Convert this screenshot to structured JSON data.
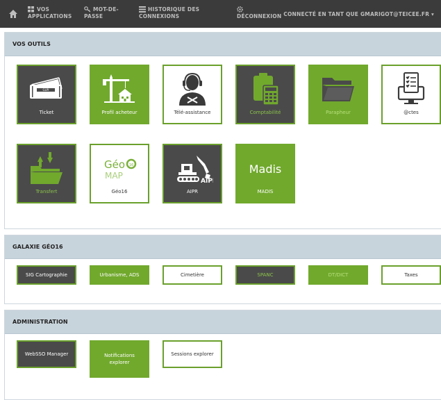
{
  "nav": {
    "apps": "VOS APPLICATIONS",
    "apps_line1": "VOS",
    "apps_line2": "APPLICATIONS",
    "pwd_line1": "MOT-DE-",
    "pwd_line2": "PASSE",
    "hist_line1": "HISTORIQUE DES",
    "hist_line2": "CONNEXIONS",
    "logout": "DÉCONNEXION",
    "user": "CONNECTÉ EN TANT QUE GMARIGOT@TEICEE.FR"
  },
  "tools": {
    "title": "VOS OUTILS",
    "tiles": [
      {
        "label": "Ticket",
        "icon": "ticket-icon"
      },
      {
        "label": "Profil acheteur",
        "icon": "crane-icon"
      },
      {
        "label": "Télé-assistance",
        "icon": "headset-icon"
      },
      {
        "label": "Comptabilité",
        "icon": "calculator-icon"
      },
      {
        "label": "Parapheur",
        "icon": "folder-icon"
      },
      {
        "label": "@ctes",
        "icon": "monitor-checklist-icon"
      },
      {
        "label": "Transfert",
        "icon": "folder-transfer-icon"
      },
      {
        "label": "Géo16",
        "icon": "geo16-logo",
        "logo_top": "GéoC",
        "logo_bottom": "MAP",
        "logo_badge": "16"
      },
      {
        "label": "AIPR",
        "icon": "excavator-icon",
        "logo_text": "AIPR"
      },
      {
        "label": "MADIS",
        "icon": "madis-logo",
        "logo_text": "Madis"
      }
    ]
  },
  "geo": {
    "title": "GALAXIE GÉO16",
    "buttons": [
      "SIG Cartographie",
      "Urbanisme, ADS",
      "Cimetière",
      "SPANC",
      "DT/DICT",
      "Taxes"
    ]
  },
  "admin": {
    "title": "ADMINISTRATION",
    "buttons": [
      "WebSSO Manager",
      "Notifications explorer",
      "Sessions explorer"
    ]
  },
  "colors": {
    "nav": "#3b3b3b",
    "green": "#71a92d",
    "dark_tile": "#4a4a4a",
    "panel_head": "#c8d4dc"
  }
}
